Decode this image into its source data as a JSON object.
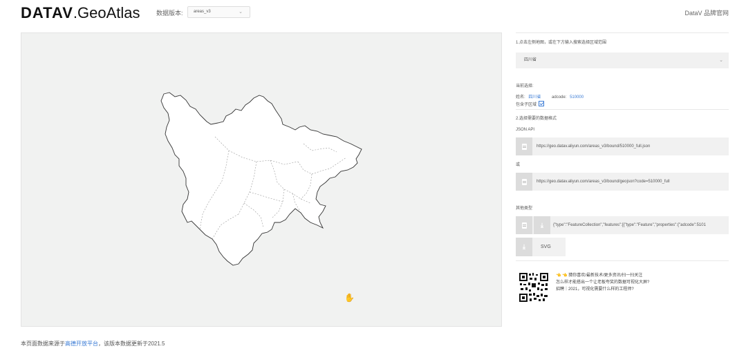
{
  "header": {
    "logo_bold": "DATAV",
    "logo_light": ".GeoAtlas",
    "version_label": "数据版本:",
    "version_value": "areas_v3",
    "brand_link": "DataV 品牌官网"
  },
  "map": {
    "region_shape": "sichuan-province-outline",
    "cursor_icon": "hand-cursor"
  },
  "panel": {
    "step1": "1.点击左侧地图，或在下方输入搜索选择区域范围",
    "region_value": "四川省",
    "current_label": "当前选择:",
    "name_label": "姓名:",
    "name_value": "四川省",
    "adcode_label": "adcode:",
    "adcode_value": "510000",
    "include_sub_label": "包含子区域",
    "include_sub_checked": true,
    "step2": "2.选择需要的数据格式",
    "json_api_label": "JSON API",
    "url1": "https://geo.datav.aliyun.com/areas_v3/bound/510000_full.json",
    "or_label": "或",
    "url2": "https://geo.datav.aliyun.com/areas_v3/bound/geojson?code=510000_full",
    "other_label": "其他类型",
    "geojson_preview": "{\"type\":\"FeatureCollection\",\"features\":[{\"type\":\"Feature\",\"properties\":{\"adcode\":5101",
    "svg_label": "SVG",
    "promo_line1": "👈 👈 猜你喜欢/最新技术/更多资讯/扫一扫关注",
    "promo_line2": "怎么样才能搭出一个让老板夸奖的数据可视化大屏?",
    "promo_line3": "招聘｜2021，可视化需要什么样的工程师?"
  },
  "footer": {
    "prefix": "本页面数据来源于",
    "link": "高德开放平台",
    "suffix": "，该版本数据更新于2021.5"
  },
  "colors": {
    "accent": "#3a7bd5",
    "map_bg": "#f1f2f1",
    "box_bg": "#f1f1f1"
  }
}
